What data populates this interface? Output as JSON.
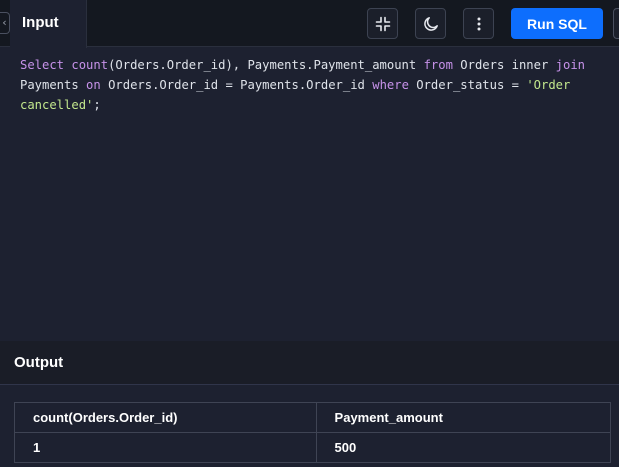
{
  "toolbar": {
    "tab_label": "Input",
    "run_label": "Run SQL",
    "icons": [
      "collapse-icon",
      "moon-icon",
      "more-vertical-icon"
    ],
    "accent_color": "#0d6efd"
  },
  "editor": {
    "code_line_1_a": "Select",
    "code_line_1_b": "count",
    "code_line_1_c": "(Orders.Order_id), Payments.Payment_amount ",
    "code_line_1_d": "from",
    "code_line_1_e": " Orders inner ",
    "code_line_1_f": "join",
    "code_line_2_a": "Payments ",
    "code_line_2_b": "on",
    "code_line_2_c": " Orders.Order_id = Payments.Order_id ",
    "code_line_2_d": "where",
    "code_line_2_e": " Order_status = ",
    "code_line_2_f": "'Order",
    "code_line_3_a": "cancelled'",
    "code_line_3_b": ";"
  },
  "output": {
    "title": "Output",
    "columns": [
      "count(Orders.Order_id)",
      "Payment_amount"
    ],
    "rows": [
      [
        "1",
        "500"
      ]
    ]
  }
}
